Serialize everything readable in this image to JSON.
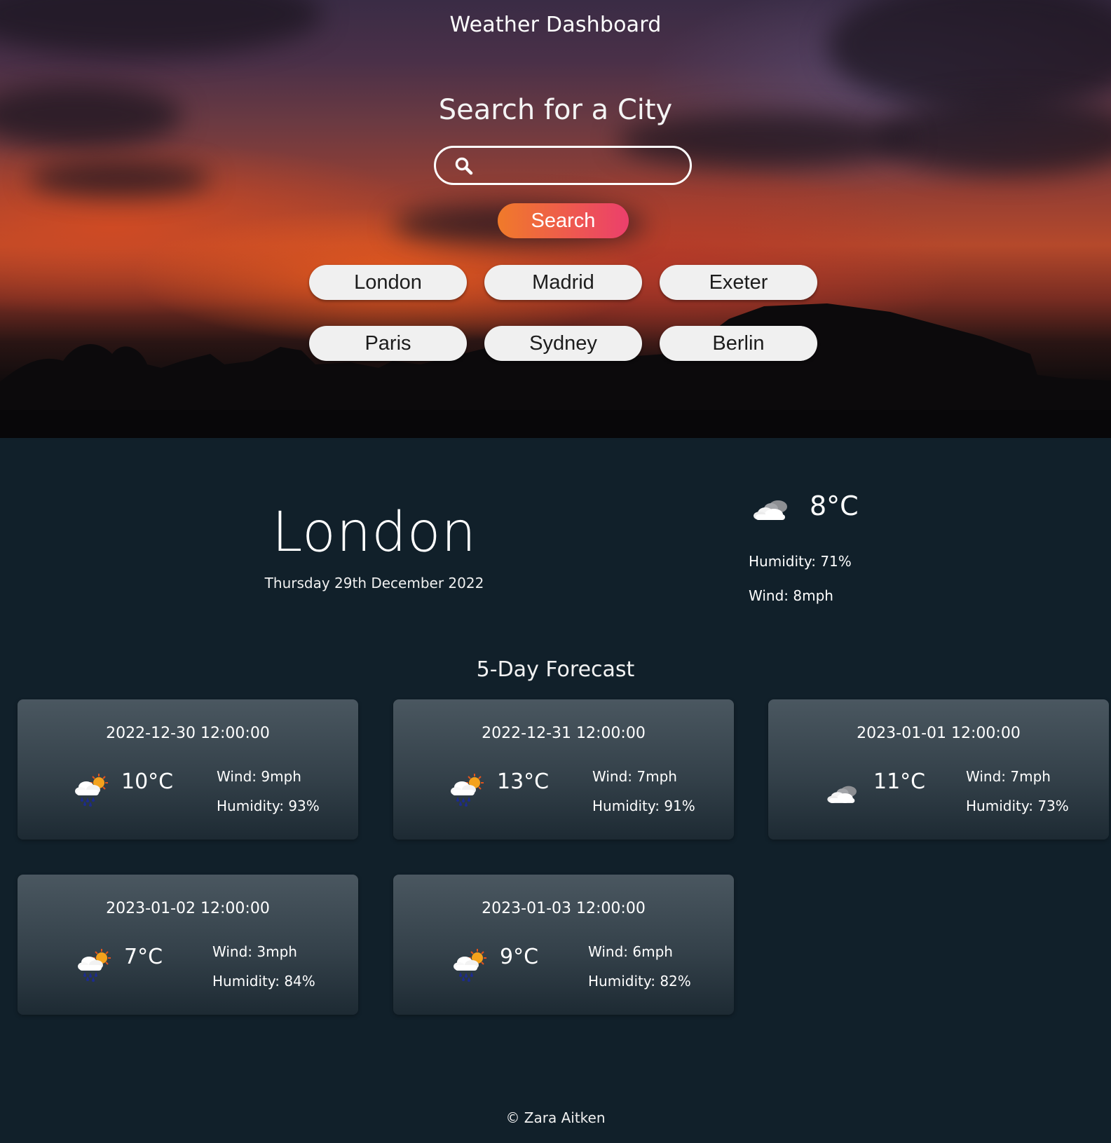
{
  "header": {
    "title": "Weather Dashboard"
  },
  "search": {
    "heading": "Search for a City",
    "placeholder": "",
    "value": "",
    "button_label": "Search",
    "icon": "search-icon"
  },
  "quick_cities": [
    "London",
    "Madrid",
    "Exeter",
    "Paris",
    "Sydney",
    "Berlin"
  ],
  "current": {
    "city": "London",
    "date": "Thursday 29th December 2022",
    "icon": "cloudy-icon",
    "temp": "8°C",
    "humidity": "Humidity: 71%",
    "wind": "Wind: 8mph"
  },
  "forecast": {
    "heading": "5-Day Forecast",
    "days": [
      {
        "date": "2022-12-30 12:00:00",
        "icon": "rain-sun-icon",
        "temp": "10°C",
        "wind": "Wind: 9mph",
        "humidity": "Humidity: 93%"
      },
      {
        "date": "2022-12-31 12:00:00",
        "icon": "rain-sun-icon",
        "temp": "13°C",
        "wind": "Wind: 7mph",
        "humidity": "Humidity: 91%"
      },
      {
        "date": "2023-01-01 12:00:00",
        "icon": "cloudy-icon",
        "temp": "11°C",
        "wind": "Wind: 7mph",
        "humidity": "Humidity: 73%"
      },
      {
        "date": "2023-01-02 12:00:00",
        "icon": "rain-sun-icon",
        "temp": "7°C",
        "wind": "Wind: 3mph",
        "humidity": "Humidity: 84%"
      },
      {
        "date": "2023-01-03 12:00:00",
        "icon": "rain-sun-icon",
        "temp": "9°C",
        "wind": "Wind: 6mph",
        "humidity": "Humidity: 82%"
      }
    ]
  },
  "footer": {
    "text": "© Zara Aitken"
  },
  "colors": {
    "page_bg": "#11202a",
    "search_btn_start": "#f07a2a",
    "search_btn_end": "#ec3f6c",
    "city_btn_bg": "#f0f0f0"
  }
}
